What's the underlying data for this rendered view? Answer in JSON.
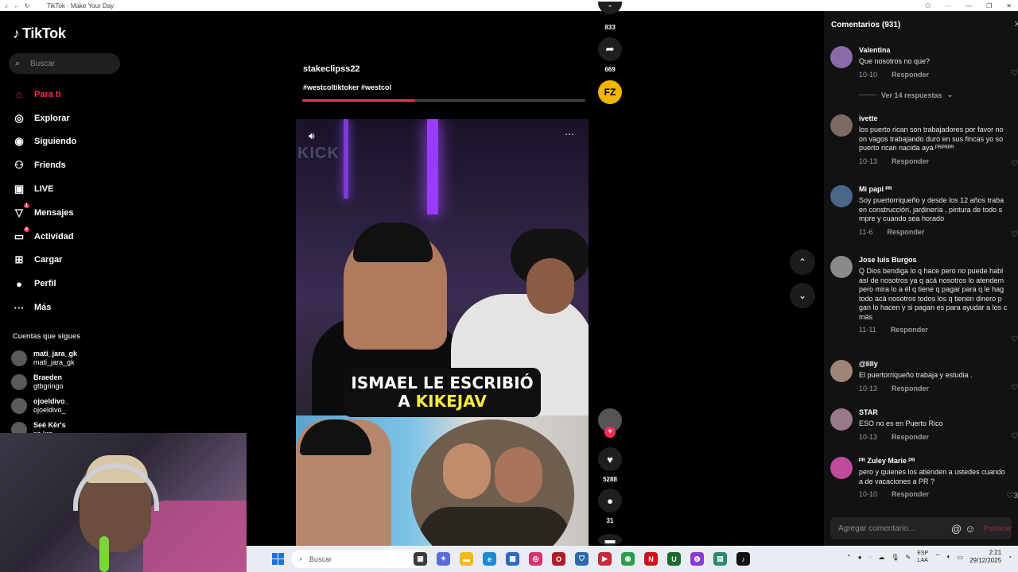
{
  "browser": {
    "title": "TikTok - Make Your Day"
  },
  "sidebar": {
    "logo": "TikTok",
    "search_placeholder": "Buscar",
    "nav": [
      {
        "label": "Para ti",
        "icon": "home-icon"
      },
      {
        "label": "Explorar",
        "icon": "compass-icon"
      },
      {
        "label": "Siguiendo",
        "icon": "following-icon"
      },
      {
        "label": "Friends",
        "icon": "friends-icon"
      },
      {
        "label": "LIVE",
        "icon": "live-icon"
      },
      {
        "label": "Mensajes",
        "icon": "messages-icon",
        "badge": "1"
      },
      {
        "label": "Actividad",
        "icon": "activity-icon",
        "badge": "4"
      },
      {
        "label": "Cargar",
        "icon": "upload-icon"
      },
      {
        "label": "Perfil",
        "icon": "profile-icon"
      },
      {
        "label": "Más",
        "icon": "more-icon"
      }
    ],
    "following_title": "Cuentas que sigues",
    "following": [
      {
        "name": "mati_jara_gk",
        "handle": "mati_jara_gk"
      },
      {
        "name": "Braeden",
        "handle": "gtbgringo"
      },
      {
        "name": "ojoeldivo_",
        "handle": "ojoeldivo_"
      },
      {
        "name": "Seë Kēr's",
        "handle": "se.krs"
      }
    ]
  },
  "video": {
    "username": "stakeclipss22",
    "hashtags": "#westcoltiktoker #westcol",
    "progress": 0.4,
    "caption_line1_white": "ISMAEL LE ESCRIBIÓ",
    "caption_line2_white": "A ",
    "caption_line2_yellow": "KIKEJAV",
    "bg_text": "KICK"
  },
  "actions": {
    "saves": "833",
    "shares": "669",
    "likes": "5288",
    "comments": "31",
    "creator_badge": "FZ"
  },
  "comments_panel": {
    "title": "Comentarios (931)",
    "more_replies": "Ver 14 respuestas",
    "input_placeholder": "Agregar comentario...",
    "post_label": "Publicar",
    "items": [
      {
        "name": "Valentina",
        "text": "Que nosotros no que?",
        "date": "10-10",
        "reply": "Responder",
        "likes": ""
      },
      {
        "name": "ivette",
        "text": "los puerto rican son trabajadores por favor no\non vagos trabajando duro en sus fincas yo so\npuerto rican nacida aya ᴾᴿᴾᴿᴾᴿ",
        "date": "10-13",
        "reply": "Responder",
        "likes": ""
      },
      {
        "name": "Mi papi ᴾᴿ",
        "text": "Soy puertorriqueño y desde los 12 años traba\nen construcción, jardinería , pintura de todo s\nmpre y cuando sea horado",
        "date": "11-6",
        "reply": "Responder",
        "likes": ""
      },
      {
        "name": "Jose luis Burgos",
        "text": "Q Dios bendiga lo q hace pero no puede habl\nasí de nosotros ya q acá nosotros lo atendem\npero mira lo a él q tiene q pagar para q le hag\ntodo acá nosotros todos los q tienen dinero p\ngan lo hacen y si pagan es para ayudar a los c\nmás",
        "date": "11-11",
        "reply": "Responder",
        "likes": ""
      },
      {
        "name": "@lilly",
        "text": "El puertorriqueño trabaja y estudia .",
        "date": "10-13",
        "reply": "Responder",
        "likes": ""
      },
      {
        "name": "STAR",
        "text": "ESO no es en Puerto Rico",
        "date": "10-13",
        "reply": "Responder",
        "likes": ""
      },
      {
        "name": "ᴾᴿ Zuley Marie ᴾᴿ",
        "text": "pero y quienes los atienden a ustedes cuando\na de vacaciones a PR ?",
        "date": "10-10",
        "reply": "Responder",
        "likes": "3"
      }
    ]
  },
  "taskbar": {
    "search_placeholder": "Buscar",
    "lang_top": "ESP",
    "lang_bottom": "LAA",
    "time": "2:21",
    "date": "29/12/2025"
  },
  "colors": {
    "accent": "#fe2c55",
    "caption_yellow": "#f7ec3e",
    "panel_bg": "#121212"
  }
}
